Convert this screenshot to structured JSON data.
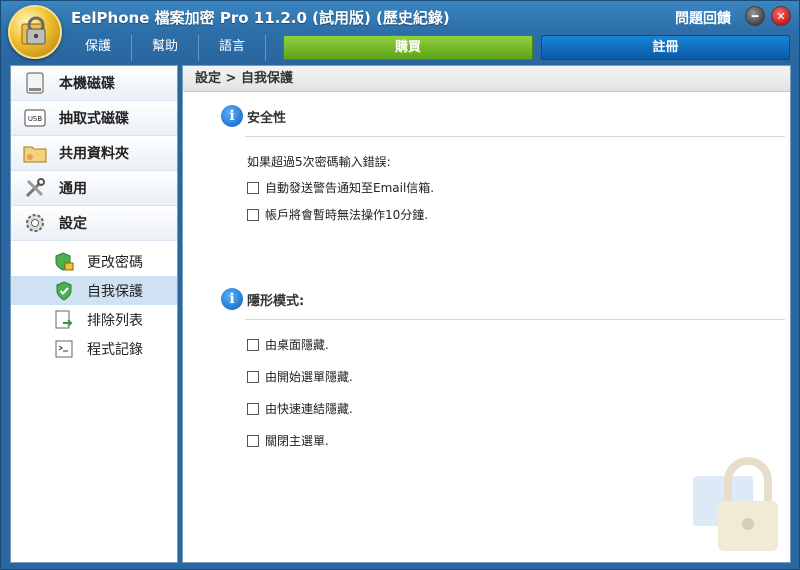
{
  "window": {
    "title": "EelPhone 檔案加密 Pro 11.2.0 (試用版) (歷史紀錄)",
    "feedback_label": "問題回饋",
    "minimize_glyph": "━",
    "close_glyph": "✕"
  },
  "menu": {
    "items": [
      {
        "label": "保護"
      },
      {
        "label": "幫助"
      },
      {
        "label": "語言"
      }
    ],
    "buy_label": "購買",
    "register_label": "註冊"
  },
  "sidebar": {
    "items": [
      {
        "label": "本機磁碟",
        "icon": "hard-drive-icon"
      },
      {
        "label": "抽取式磁碟",
        "icon": "usb-drive-icon"
      },
      {
        "label": "共用資料夾",
        "icon": "shared-folder-icon"
      },
      {
        "label": "通用",
        "icon": "tools-icon"
      },
      {
        "label": "設定",
        "icon": "gear-icon"
      }
    ],
    "sub_items": [
      {
        "label": "更改密碼",
        "icon": "shield-lock-icon",
        "active": false
      },
      {
        "label": "自我保護",
        "icon": "shield-check-icon",
        "active": true
      },
      {
        "label": "排除列表",
        "icon": "exclude-list-icon",
        "active": false
      },
      {
        "label": "程式記錄",
        "icon": "program-log-icon",
        "active": false
      }
    ]
  },
  "content": {
    "breadcrumb": "設定 > 自我保護",
    "security": {
      "title": "安全性",
      "prompt": "如果超過5次密碼輸入錯誤:",
      "options": [
        {
          "label": "自動發送警告通知至Email信箱.",
          "checked": false
        },
        {
          "label": "帳戶將會暫時無法操作10分鐘.",
          "checked": false
        }
      ]
    },
    "stealth": {
      "title": "隱形模式:",
      "options": [
        {
          "label": "由桌面隱藏.",
          "checked": false
        },
        {
          "label": "由開始選單隱藏.",
          "checked": false
        },
        {
          "label": "由快速連結隱藏.",
          "checked": false
        },
        {
          "label": "關閉主選單.",
          "checked": false
        }
      ]
    }
  },
  "colors": {
    "title_bar": "#2d6fa8",
    "buy_button": "#6fb824",
    "register_button": "#0a64b8",
    "active_sub_item": "#cfe2f3"
  }
}
